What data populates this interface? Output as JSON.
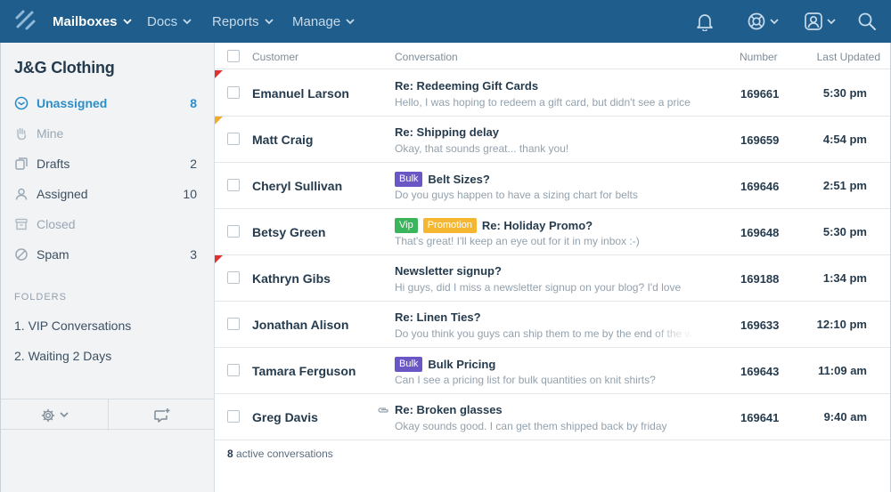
{
  "nav": {
    "items": [
      {
        "label": "Mailboxes",
        "active": true
      },
      {
        "label": "Docs",
        "active": false
      },
      {
        "label": "Reports",
        "active": false
      },
      {
        "label": "Manage",
        "active": false
      }
    ],
    "icons": [
      "bell-icon",
      "help-lifebuoy-icon",
      "user-account-icon",
      "search-icon"
    ],
    "colors": {
      "bar": "#1f5e8c",
      "active": "#ffffff",
      "inactive": "#c6daea"
    }
  },
  "sidebar": {
    "title": "J&G Clothing",
    "items": [
      {
        "label": "Unassigned",
        "count": "8",
        "icon": "inbox-icon",
        "active": true
      },
      {
        "label": "Mine",
        "count": "",
        "icon": "hand-icon",
        "muted": true
      },
      {
        "label": "Drafts",
        "count": "2",
        "icon": "drafts-icon"
      },
      {
        "label": "Assigned",
        "count": "10",
        "icon": "person-icon"
      },
      {
        "label": "Closed",
        "count": "",
        "icon": "archive-icon",
        "muted": true
      },
      {
        "label": "Spam",
        "count": "3",
        "icon": "blocked-icon"
      }
    ],
    "folders_heading": "FOLDERS",
    "folders": [
      "1. VIP Conversations",
      "2. Waiting 2 Days"
    ],
    "footer_icons": [
      "gear-icon",
      "new-conversation-icon"
    ]
  },
  "table": {
    "headers": {
      "customer": "Customer",
      "conversation": "Conversation",
      "number": "Number",
      "last_updated": "Last Updated"
    },
    "rows": [
      {
        "customer": "Emanuel Larson",
        "tags": [],
        "subject": "Re: Redeeming Gift Cards",
        "preview": "Hello, I was hoping to redeem a gift card, but didn't see a price",
        "number": "169661",
        "updated": "5:30 pm",
        "flag": "#e0312e"
      },
      {
        "customer": "Matt Craig",
        "tags": [],
        "subject": "Re: Shipping delay",
        "preview": "Okay, that sounds great... thank you!",
        "number": "169659",
        "updated": "4:54 pm",
        "flag": "#f2ac2a"
      },
      {
        "customer": "Cheryl Sullivan",
        "tags": [
          {
            "label": "Bulk",
            "color": "#6a56c4"
          }
        ],
        "subject": "Belt Sizes?",
        "preview": "Do you guys happen to have a sizing chart for belts",
        "number": "169646",
        "updated": "2:51 pm",
        "flag": ""
      },
      {
        "customer": "Betsy Green",
        "tags": [
          {
            "label": "Vip",
            "color": "#3ab55b"
          },
          {
            "label": "Promotion",
            "color": "#f5b731"
          }
        ],
        "subject": "Re: Holiday Promo?",
        "preview": "That's great! I'll keep an eye out for it in my inbox :-)",
        "number": "169648",
        "updated": "5:30 pm",
        "flag": ""
      },
      {
        "customer": "Kathryn Gibs",
        "tags": [],
        "subject": "Newsletter signup?",
        "preview": "Hi guys, did I miss a newsletter signup on your blog? I'd love",
        "number": "169188",
        "updated": "1:34 pm",
        "flag": "#e0312e"
      },
      {
        "customer": "Jonathan Alison",
        "tags": [],
        "subject": "Re: Linen Ties?",
        "preview": "Do you think you guys can ship them to me by the end of the week",
        "number": "169633",
        "updated": "12:10 pm",
        "flag": "",
        "fade": true
      },
      {
        "customer": "Tamara Ferguson",
        "tags": [
          {
            "label": "Bulk",
            "color": "#6a56c4"
          }
        ],
        "subject": "Bulk Pricing",
        "preview": "Can I see a pricing list for bulk quantities on knit shirts?",
        "number": "169643",
        "updated": "11:09 am",
        "flag": ""
      },
      {
        "customer": "Greg Davis",
        "tags": [],
        "subject": "Re: Broken glasses",
        "preview": "Okay sounds good. I can get them shipped back by friday",
        "number": "169641",
        "updated": "9:40 am",
        "flag": "",
        "attachment": true
      }
    ],
    "footer": {
      "count": "8",
      "text": "active conversations"
    }
  }
}
